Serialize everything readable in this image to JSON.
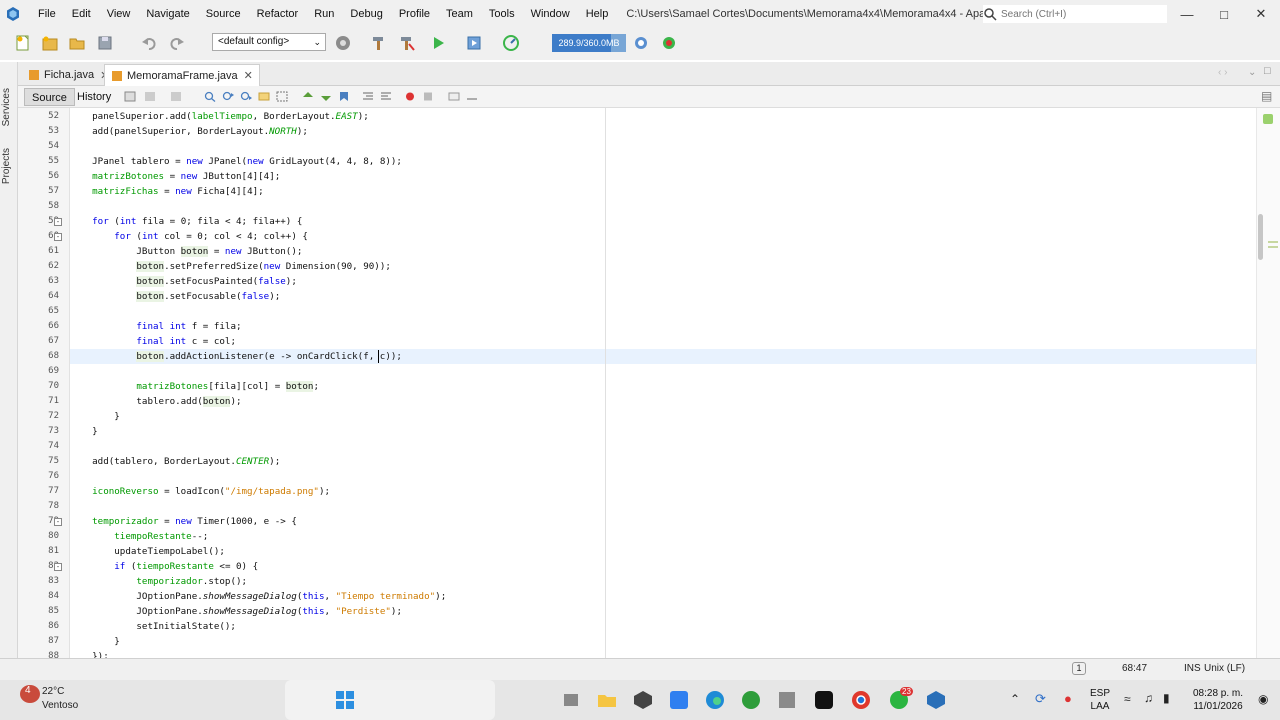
{
  "menubar": {
    "items": [
      "File",
      "Edit",
      "View",
      "Navigate",
      "Source",
      "Refactor",
      "Run",
      "Debug",
      "Profile",
      "Team",
      "Tools",
      "Window",
      "Help"
    ],
    "title": "C:\\Users\\Samael Cortes\\Documents\\Memorama4x4\\Memorama4x4 - Apache NetBeans IDE 27",
    "search_placeholder": "Search (Ctrl+I)"
  },
  "toolbar": {
    "config": "<default config>",
    "memory": "289.9/360.0MB",
    "memory_fraction": 0.8
  },
  "side_panels": [
    "Services",
    "Projects"
  ],
  "tabs": [
    {
      "label": "Ficha.java",
      "active": false
    },
    {
      "label": "MemoramaFrame.java",
      "active": true
    }
  ],
  "editor_tabs": [
    "Source",
    "History"
  ],
  "code_lines": [
    {
      "n": "52",
      "fold": "",
      "hl": false,
      "html": "    panelSuperior.add(<span class=\"fld\">labelTiempo</span>, BorderLayout.<span class=\"fld it\">EAST</span>);"
    },
    {
      "n": "53",
      "fold": "",
      "hl": false,
      "html": "    add(panelSuperior, BorderLayout.<span class=\"fld it\">NORTH</span>);"
    },
    {
      "n": "54",
      "fold": "",
      "hl": false,
      "html": ""
    },
    {
      "n": "55",
      "fold": "",
      "hl": false,
      "html": "    JPanel tablero = <span class=\"kw\">new</span> JPanel(<span class=\"kw\">new</span> GridLayout(4, 4, 8, 8));"
    },
    {
      "n": "56",
      "fold": "",
      "hl": false,
      "html": "    <span class=\"fld\">matrizBotones</span> = <span class=\"kw\">new</span> JButton[4][4];"
    },
    {
      "n": "57",
      "fold": "",
      "hl": false,
      "html": "    <span class=\"fld\">matrizFichas</span> = <span class=\"kw\">new</span> Ficha[4][4];"
    },
    {
      "n": "58",
      "fold": "",
      "hl": false,
      "html": ""
    },
    {
      "n": "59",
      "fold": "-",
      "hl": false,
      "html": "    <span class=\"kw\">for</span> (<span class=\"kw\">int</span> fila = 0; fila &lt; 4; fila++) {"
    },
    {
      "n": "60",
      "fold": "-",
      "hl": false,
      "html": "        <span class=\"kw\">for</span> (<span class=\"kw\">int</span> col = 0; col &lt; 4; col++) {"
    },
    {
      "n": "61",
      "fold": "",
      "hl": false,
      "html": "            JButton <span class=\"var\">boton</span> = <span class=\"kw\">new</span> JButton();"
    },
    {
      "n": "62",
      "fold": "",
      "hl": false,
      "html": "            <span class=\"var\">boton</span>.setPreferredSize(<span class=\"kw\">new</span> Dimension(90, 90));"
    },
    {
      "n": "63",
      "fold": "",
      "hl": false,
      "html": "            <span class=\"var\">boton</span>.setFocusPainted(<span class=\"kw\">false</span>);"
    },
    {
      "n": "64",
      "fold": "",
      "hl": false,
      "html": "            <span class=\"var\">boton</span>.setFocusable(<span class=\"kw\">false</span>);"
    },
    {
      "n": "65",
      "fold": "",
      "hl": false,
      "html": ""
    },
    {
      "n": "66",
      "fold": "",
      "hl": false,
      "html": "            <span class=\"kw\">final int</span> f = fila;"
    },
    {
      "n": "67",
      "fold": "",
      "hl": false,
      "html": "            <span class=\"kw\">final int</span> c = col;"
    },
    {
      "n": "68",
      "fold": "",
      "hl": true,
      "html": "            <span class=\"var\">boton</span>.addActionListener(e -&gt; onCardClick(f, c));"
    },
    {
      "n": "69",
      "fold": "",
      "hl": false,
      "html": ""
    },
    {
      "n": "70",
      "fold": "",
      "hl": false,
      "html": "            <span class=\"fld\">matrizBotones</span>[fila][col] = <span class=\"var\">boton</span>;"
    },
    {
      "n": "71",
      "fold": "",
      "hl": false,
      "html": "            tablero.add(<span class=\"var\">boton</span>);"
    },
    {
      "n": "72",
      "fold": "",
      "hl": false,
      "html": "        }"
    },
    {
      "n": "73",
      "fold": "",
      "hl": false,
      "html": "    }"
    },
    {
      "n": "74",
      "fold": "",
      "hl": false,
      "html": ""
    },
    {
      "n": "75",
      "fold": "",
      "hl": false,
      "html": "    add(tablero, BorderLayout.<span class=\"fld it\">CENTER</span>);"
    },
    {
      "n": "76",
      "fold": "",
      "hl": false,
      "html": ""
    },
    {
      "n": "77",
      "fold": "",
      "hl": false,
      "html": "    <span class=\"fld\">iconoReverso</span> = loadIcon(<span class=\"str\">\"/img/tapada.png\"</span>);"
    },
    {
      "n": "78",
      "fold": "",
      "hl": false,
      "html": ""
    },
    {
      "n": "79",
      "fold": "-",
      "hl": false,
      "html": "    <span class=\"fld\">temporizador</span> = <span class=\"kw\">new</span> Timer(1000, e -&gt; {"
    },
    {
      "n": "80",
      "fold": "",
      "hl": false,
      "html": "        <span class=\"fld\">tiempoRestante</span>--;"
    },
    {
      "n": "81",
      "fold": "",
      "hl": false,
      "html": "        updateTiempoLabel();"
    },
    {
      "n": "82",
      "fold": "-",
      "hl": false,
      "html": "        <span class=\"kw\">if</span> (<span class=\"fld\">tiempoRestante</span> &lt;= 0) {"
    },
    {
      "n": "83",
      "fold": "",
      "hl": false,
      "html": "            <span class=\"fld\">temporizador</span>.stop();"
    },
    {
      "n": "84",
      "fold": "",
      "hl": false,
      "html": "            JOptionPane.<span class=\"it\">showMessageDialog</span>(<span class=\"kw\">this</span>, <span class=\"str\">\"Tiempo terminado\"</span>);"
    },
    {
      "n": "85",
      "fold": "",
      "hl": false,
      "html": "            JOptionPane.<span class=\"it\">showMessageDialog</span>(<span class=\"kw\">this</span>, <span class=\"str\">\"Perdiste\"</span>);"
    },
    {
      "n": "86",
      "fold": "",
      "hl": false,
      "html": "            setInitialState();"
    },
    {
      "n": "87",
      "fold": "",
      "hl": false,
      "html": "        }"
    },
    {
      "n": "88",
      "fold": "",
      "hl": false,
      "html": "    });"
    }
  ],
  "statusbar": {
    "notification_count": "1",
    "position": "68:47",
    "mode": "INS",
    "line_ending": "Unix (LF)"
  },
  "taskbar": {
    "weather_temp": "22°C",
    "weather_desc": "Ventoso",
    "weather_badge": "4",
    "whatsapp_badge": "23",
    "lang_line1": "ESP",
    "lang_line2": "LAA",
    "time": "08:28 p. m.",
    "date": "11/01/2026"
  }
}
